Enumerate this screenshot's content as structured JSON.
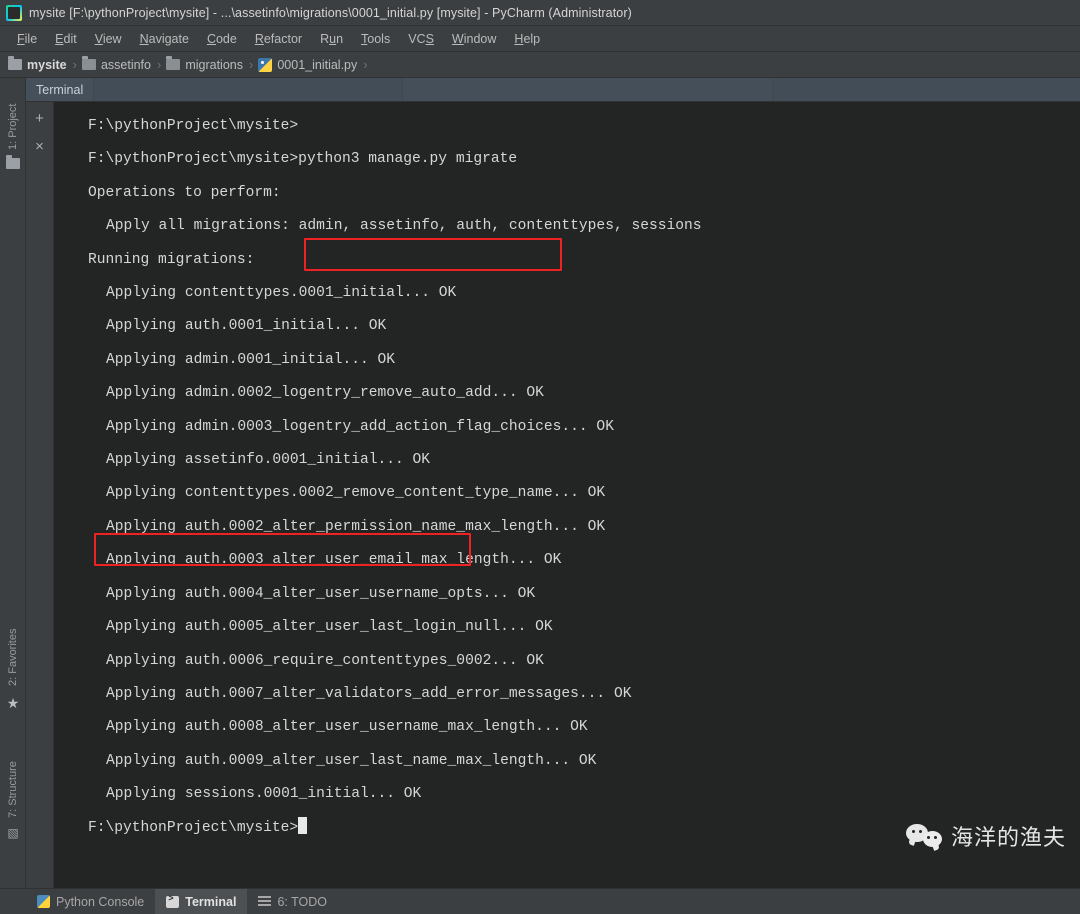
{
  "window": {
    "title": "mysite [F:\\pythonProject\\mysite] - ...\\assetinfo\\migrations\\0001_initial.py [mysite] - PyCharm (Administrator)",
    "app_icon": "pycharm-logo-icon"
  },
  "menubar": {
    "items": [
      {
        "label": "File"
      },
      {
        "label": "Edit"
      },
      {
        "label": "View"
      },
      {
        "label": "Navigate"
      },
      {
        "label": "Code"
      },
      {
        "label": "Refactor"
      },
      {
        "label": "Run"
      },
      {
        "label": "Tools"
      },
      {
        "label": "VCS"
      },
      {
        "label": "Window"
      },
      {
        "label": "Help"
      }
    ]
  },
  "breadcrumb": {
    "separator": "›",
    "items": [
      {
        "label": "mysite",
        "icon": "folder-icon"
      },
      {
        "label": "assetinfo",
        "icon": "folder-icon"
      },
      {
        "label": "migrations",
        "icon": "folder-icon"
      },
      {
        "label": "0001_initial.py",
        "icon": "python-file-icon"
      }
    ]
  },
  "left_tool_strip": {
    "tabs": [
      {
        "label": "1: Project",
        "icon": "folder-icon"
      },
      {
        "label": "2: Favorites",
        "icon": "star-icon"
      },
      {
        "label": "7: Structure",
        "icon": "structure-icon"
      }
    ]
  },
  "tool_window": {
    "tab_label": "Terminal",
    "gutter_buttons": [
      {
        "label": "+",
        "name": "new-session-button"
      },
      {
        "label": "×",
        "name": "close-session-button"
      }
    ]
  },
  "terminal": {
    "prompt": "F:\\pythonProject\\mysite>",
    "command": "python3 manage.py migrate",
    "lines": [
      {
        "text": "F:\\pythonProject\\mysite>",
        "indent": 0
      },
      {
        "text": "F:\\pythonProject\\mysite>python3 manage.py migrate",
        "indent": 0
      },
      {
        "text": "Operations to perform:",
        "indent": 0
      },
      {
        "text": "Apply all migrations: admin, assetinfo, auth, contenttypes, sessions",
        "indent": 1
      },
      {
        "text": "Running migrations:",
        "indent": 0
      },
      {
        "text": "Applying contenttypes.0001_initial... OK",
        "indent": 1
      },
      {
        "text": "Applying auth.0001_initial... OK",
        "indent": 1
      },
      {
        "text": "Applying admin.0001_initial... OK",
        "indent": 1
      },
      {
        "text": "Applying admin.0002_logentry_remove_auto_add... OK",
        "indent": 1
      },
      {
        "text": "Applying admin.0003_logentry_add_action_flag_choices... OK",
        "indent": 1
      },
      {
        "text": "Applying assetinfo.0001_initial... OK",
        "indent": 1
      },
      {
        "text": "Applying contenttypes.0002_remove_content_type_name... OK",
        "indent": 1
      },
      {
        "text": "Applying auth.0002_alter_permission_name_max_length... OK",
        "indent": 1
      },
      {
        "text": "Applying auth.0003_alter_user_email_max_length... OK",
        "indent": 1
      },
      {
        "text": "Applying auth.0004_alter_user_username_opts... OK",
        "indent": 1
      },
      {
        "text": "Applying auth.0005_alter_user_last_login_null... OK",
        "indent": 1
      },
      {
        "text": "Applying auth.0006_require_contenttypes_0002... OK",
        "indent": 1
      },
      {
        "text": "Applying auth.0007_alter_validators_add_error_messages... OK",
        "indent": 1
      },
      {
        "text": "Applying auth.0008_alter_user_username_max_length... OK",
        "indent": 1
      },
      {
        "text": "Applying auth.0009_alter_user_last_name_max_length... OK",
        "indent": 1
      },
      {
        "text": "Applying sessions.0001_initial... OK",
        "indent": 1
      },
      {
        "text": "",
        "indent": 0
      },
      {
        "text": "F:\\pythonProject\\mysite>",
        "indent": 0,
        "caret": true
      }
    ]
  },
  "annotations": {
    "color": "#ee2222",
    "boxes": [
      {
        "name": "command-highlight",
        "target": "python3 manage.py migrate"
      },
      {
        "name": "assetinfo-migration-highlight",
        "target": "Applying assetinfo.0001_initial... OK"
      }
    ]
  },
  "watermark": {
    "text": "海洋的渔夫",
    "icon": "wechat-icon"
  },
  "statusbar": {
    "items": [
      {
        "label": "Python Console",
        "icon": "python-console-icon",
        "active": false
      },
      {
        "label": "Terminal",
        "icon": "terminal-icon",
        "active": true
      },
      {
        "label": "6: TODO",
        "icon": "todo-icon",
        "active": false
      }
    ]
  },
  "colors": {
    "chrome": "#3c3f41",
    "console_bg": "#232525",
    "toolwindow_header": "#46505a",
    "text": "#d6d6d6",
    "accent_red": "#ee2222"
  }
}
